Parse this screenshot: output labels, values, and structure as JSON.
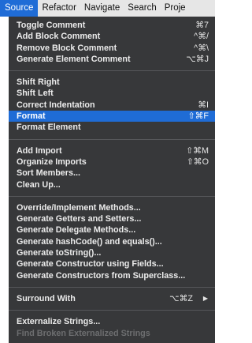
{
  "menubar": {
    "items": [
      {
        "label": "Source",
        "active": true
      },
      {
        "label": "Refactor"
      },
      {
        "label": "Navigate"
      },
      {
        "label": "Search"
      },
      {
        "label": "Proje"
      }
    ]
  },
  "menu": {
    "groups": [
      [
        {
          "label": "Toggle Comment",
          "shortcut": "⌘7"
        },
        {
          "label": "Add Block Comment",
          "shortcut": "^⌘/"
        },
        {
          "label": "Remove Block Comment",
          "shortcut": "^⌘\\"
        },
        {
          "label": "Generate Element Comment",
          "shortcut": "⌥⌘J"
        }
      ],
      [
        {
          "label": "Shift Right",
          "shortcut": ""
        },
        {
          "label": "Shift Left",
          "shortcut": ""
        },
        {
          "label": "Correct Indentation",
          "shortcut": "⌘I"
        },
        {
          "label": "Format",
          "shortcut": "⇧⌘F",
          "selected": true
        },
        {
          "label": "Format Element",
          "shortcut": ""
        }
      ],
      [
        {
          "label": "Add Import",
          "shortcut": "⇧⌘M"
        },
        {
          "label": "Organize Imports",
          "shortcut": "⇧⌘O"
        },
        {
          "label": "Sort Members...",
          "shortcut": ""
        },
        {
          "label": "Clean Up...",
          "shortcut": ""
        }
      ],
      [
        {
          "label": "Override/Implement Methods...",
          "shortcut": ""
        },
        {
          "label": "Generate Getters and Setters...",
          "shortcut": ""
        },
        {
          "label": "Generate Delegate Methods...",
          "shortcut": ""
        },
        {
          "label": "Generate hashCode() and equals()...",
          "shortcut": ""
        },
        {
          "label": "Generate toString()...",
          "shortcut": ""
        },
        {
          "label": "Generate Constructor using Fields...",
          "shortcut": ""
        },
        {
          "label": "Generate Constructors from Superclass...",
          "shortcut": ""
        }
      ],
      [
        {
          "label": "Surround With",
          "shortcut": "⌥⌘Z",
          "submenu": true
        }
      ],
      [
        {
          "label": "Externalize Strings...",
          "shortcut": ""
        },
        {
          "label": "Find Broken Externalized Strings",
          "shortcut": "",
          "disabled": true
        }
      ]
    ]
  },
  "icons": {
    "submenu_arrow": "▶"
  },
  "colors": {
    "menubar_bg": "#e6e6e6",
    "menu_bg": "#37383a",
    "highlight": "#1f6cd6",
    "text": "#ececec",
    "disabled_text": "#6d6e70"
  }
}
